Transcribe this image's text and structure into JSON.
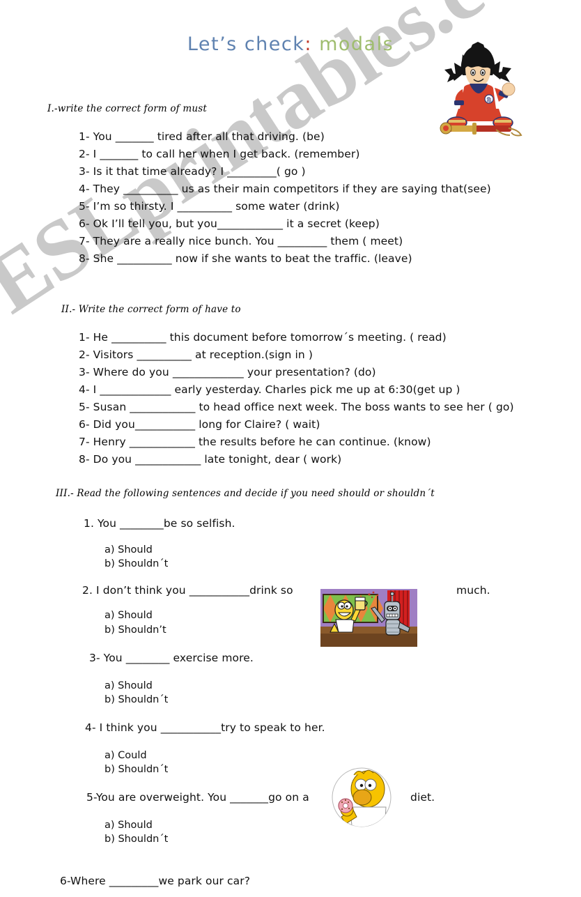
{
  "document": {
    "title_prefix": "Let’s check",
    "title_colon": ":",
    "title_topic": "modals",
    "watermark": "ESLprintables.com",
    "colors": {
      "title_blue": "#5f82b0",
      "title_green": "#9fbd6e",
      "title_colon_red": "#c0392b",
      "watermark_gray": "#c9c9c9",
      "text_black": "#101010"
    }
  },
  "sections": [
    {
      "id": "section-1",
      "heading": "I.-write the correct form of must",
      "items": [
        "1-  You _______  tired after all that driving. (be)",
        "2-  I _______ to call her when I get back. (remember)",
        "3-  Is it that time already? I _________( go )",
        "4-  They __________ us as their main competitors if they are saying that(see)",
        "5-  I’m so thirsty. I __________ some water (drink)",
        "6-  Ok I’ll tell you, but you____________ it a secret (keep)",
        "7-  They are a really nice bunch. You _________ them ( meet)",
        "8-  She __________ now if she wants to beat the traffic. (leave)"
      ]
    },
    {
      "id": "section-2",
      "heading": "II.- Write the correct form of have to",
      "items": [
        "1-  He __________ this document before tomorrow´s meeting.  ( read)",
        "2-  Visitors __________  at reception.(sign in )",
        "3-  Where do you _____________ your presentation? (do)",
        "4-  I _____________ early yesterday. Charles pick me up at 6:30(get up )",
        "5-  Susan ____________ to head office next week. The boss wants to see her ( go)",
        "6-  Did you___________ long for Claire? ( wait)",
        "7-  Henry ____________ the results before he can continue. (know)",
        "8-  Do you ____________ late tonight, dear ( work)"
      ]
    },
    {
      "id": "section-3",
      "heading": "III.- Read the following sentences and decide if you need should or shouldn´t",
      "questions": [
        {
          "prompt": "1.  You ________be so selfish.",
          "options": [
            "a) Should",
            "b) Shouldn´t"
          ]
        },
        {
          "prompt": "2.  I  don’t  think  you  ___________drink  so",
          "prompt_tail": "much.",
          "options": [
            "a) Should",
            "b) Shouldn’t"
          ],
          "image": "homer-bender-bar-image"
        },
        {
          "prompt": "3- You ________ exercise more.",
          "options": [
            "a) Should",
            "b) Shouldn´t"
          ]
        },
        {
          "prompt": "4- I think you ___________try to speak to her.",
          "options": [
            "a) Could",
            "b) Shouldn´t"
          ]
        },
        {
          "prompt": "5-You are  overweight. You _______go  on  a",
          "prompt_tail": "diet.",
          "options": [
            "a) Should",
            "b) Shouldn´t"
          ],
          "image": "homer-donut-image"
        },
        {
          "prompt": "6-Where _________we park our car?",
          "options": []
        }
      ]
    }
  ],
  "images": {
    "goku": "goku-sitting-with-sword-image",
    "bar": "homer-bender-bar-image",
    "donut": "homer-donut-image"
  }
}
